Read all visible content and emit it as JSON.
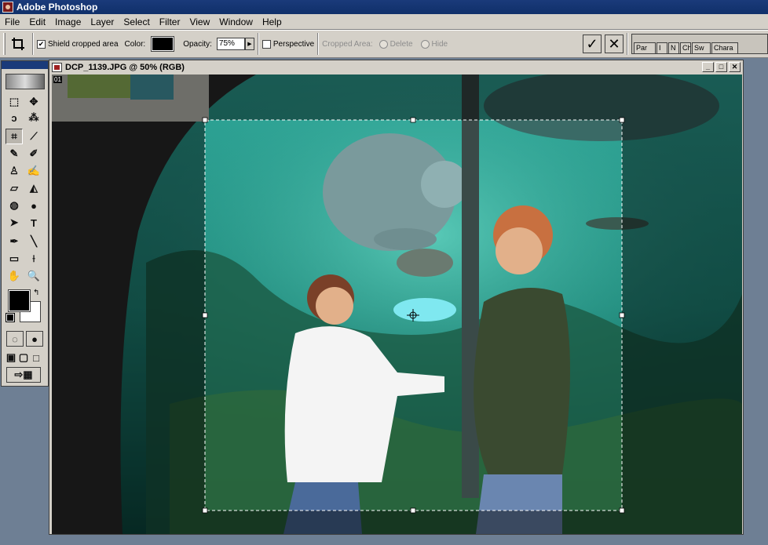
{
  "app": {
    "title": "Adobe Photoshop"
  },
  "menu": [
    "File",
    "Edit",
    "Image",
    "Layer",
    "Select",
    "Filter",
    "View",
    "Window",
    "Help"
  ],
  "options": {
    "shield_label": "Shield cropped area",
    "shield_checked": true,
    "color_label": "Color:",
    "shield_color": "#000000",
    "opacity_label": "Opacity:",
    "opacity_value": "75%",
    "perspective_label": "Perspective",
    "perspective_checked": false,
    "cropped_area_label": "Cropped Area:",
    "delete_label": "Delete",
    "hide_label": "Hide",
    "commit_glyph": "✓",
    "cancel_glyph": "✕"
  },
  "palette_well": {
    "tabs": [
      "Par",
      "I",
      "N",
      "Ch",
      "Sw",
      "Chara"
    ]
  },
  "document": {
    "title": "DCP_1139.JPG @ 50% (RGB)",
    "minimize_glyph": "_",
    "maximize_glyph": "□",
    "close_glyph": "✕",
    "corner_label": "01"
  },
  "toolbox": {
    "tools": [
      {
        "name": "marquee-tool",
        "glyph": "⬚"
      },
      {
        "name": "move-tool",
        "glyph": "✥"
      },
      {
        "name": "lasso-tool",
        "glyph": "ↄ"
      },
      {
        "name": "magic-wand-tool",
        "glyph": "⁂"
      },
      {
        "name": "crop-tool",
        "glyph": "⌗"
      },
      {
        "name": "slice-tool",
        "glyph": "⟋"
      },
      {
        "name": "healing-brush-tool",
        "glyph": "✎"
      },
      {
        "name": "brush-tool",
        "glyph": "✐"
      },
      {
        "name": "clone-stamp-tool",
        "glyph": "♙"
      },
      {
        "name": "history-brush-tool",
        "glyph": "✍"
      },
      {
        "name": "eraser-tool",
        "glyph": "▱"
      },
      {
        "name": "paint-bucket-tool",
        "glyph": "◭"
      },
      {
        "name": "blur-tool",
        "glyph": "◍"
      },
      {
        "name": "dodge-tool",
        "glyph": "●"
      },
      {
        "name": "path-selection-tool",
        "glyph": "➤"
      },
      {
        "name": "type-tool",
        "glyph": "T"
      },
      {
        "name": "pen-tool",
        "glyph": "✒"
      },
      {
        "name": "line-tool",
        "glyph": "╲"
      },
      {
        "name": "notes-tool",
        "glyph": "▭"
      },
      {
        "name": "eyedropper-tool",
        "glyph": "⟊"
      },
      {
        "name": "hand-tool",
        "glyph": "✋"
      },
      {
        "name": "zoom-tool",
        "glyph": "🔍"
      }
    ],
    "foreground_color": "#000000",
    "background_color": "#ffffff"
  }
}
